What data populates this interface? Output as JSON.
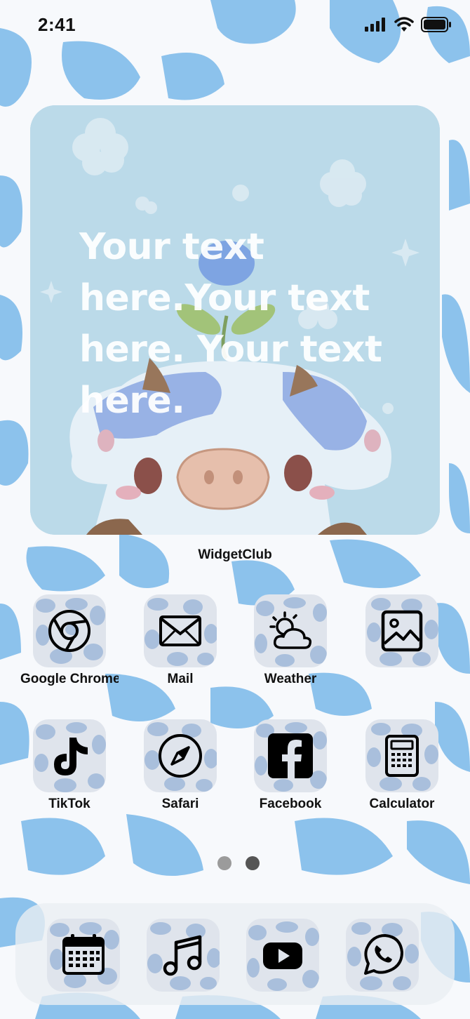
{
  "status_bar": {
    "time": "2:41",
    "icons": [
      "cellular-signal-icon",
      "wifi-icon",
      "battery-icon"
    ]
  },
  "widget": {
    "text": "Your text here.Your text here. Your text here.",
    "label": "WidgetClub"
  },
  "apps": [
    {
      "label": "Google Chrome",
      "icon": "chrome-icon"
    },
    {
      "label": "Mail",
      "icon": "mail-icon"
    },
    {
      "label": "Weather",
      "icon": "weather-icon"
    },
    {
      "label": "",
      "icon": "photos-icon"
    },
    {
      "label": "TikTok",
      "icon": "tiktok-icon"
    },
    {
      "label": "Safari",
      "icon": "compass-icon"
    },
    {
      "label": "Facebook",
      "icon": "facebook-icon"
    },
    {
      "label": "Calculator",
      "icon": "calculator-icon"
    }
  ],
  "page_indicator": {
    "count": 2,
    "active_index": 1
  },
  "dock": [
    {
      "icon": "calendar-icon"
    },
    {
      "icon": "music-icon"
    },
    {
      "icon": "youtube-icon"
    },
    {
      "icon": "whatsapp-icon"
    }
  ],
  "colors": {
    "wallpaper_spot": "#8cc2ec",
    "tile_background": "#dfe4ec",
    "tile_spot": "#a9bfdc",
    "widget_background": "#bcdaea"
  }
}
